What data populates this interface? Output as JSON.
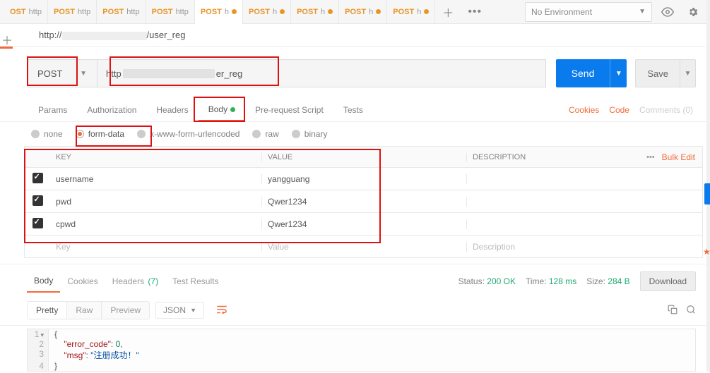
{
  "tabs": [
    {
      "method": "OST",
      "label": "http",
      "dot": false
    },
    {
      "method": "POST",
      "label": "http",
      "dot": false
    },
    {
      "method": "POST",
      "label": "http",
      "dot": false
    },
    {
      "method": "POST",
      "label": "http",
      "dot": false
    },
    {
      "method": "POST",
      "label": "h",
      "dot": true,
      "active": true
    },
    {
      "method": "POST",
      "label": "h",
      "dot": true
    },
    {
      "method": "POST",
      "label": "h",
      "dot": true
    },
    {
      "method": "POST",
      "label": "h",
      "dot": true
    },
    {
      "method": "POST",
      "label": "h",
      "dot": true
    }
  ],
  "env": {
    "label": "No Environment"
  },
  "breadcrumb": {
    "prefix": "http://",
    "suffix": "/user_reg"
  },
  "request": {
    "method": "POST",
    "url_prefix": "http",
    "url_suffix": "er_reg",
    "send": "Send",
    "save": "Save"
  },
  "req_tabs": {
    "params": "Params",
    "auth": "Authorization",
    "headers": "Headers",
    "body": "Body",
    "prereq": "Pre-request Script",
    "tests": "Tests",
    "cookies": "Cookies",
    "code": "Code",
    "comments": "Comments (0)"
  },
  "body_types": {
    "none": "none",
    "formdata": "form-data",
    "urlencoded": "x-www-form-urlencoded",
    "raw": "raw",
    "binary": "binary"
  },
  "table": {
    "key_header": "KEY",
    "value_header": "VALUE",
    "desc_header": "DESCRIPTION",
    "bulk": "Bulk Edit",
    "key_placeholder": "Key",
    "value_placeholder": "Value",
    "desc_placeholder": "Description",
    "rows": [
      {
        "key": "username",
        "value": "yangguang"
      },
      {
        "key": "pwd",
        "value": "Qwer1234"
      },
      {
        "key": "cpwd",
        "value": "Qwer1234"
      }
    ]
  },
  "response": {
    "tabs": {
      "body": "Body",
      "cookies": "Cookies",
      "headers": "Headers",
      "headers_count": "(7)",
      "tests": "Test Results"
    },
    "status_label": "Status:",
    "status": "200 OK",
    "time_label": "Time:",
    "time": "128 ms",
    "size_label": "Size:",
    "size": "284 B",
    "download": "Download",
    "view": {
      "pretty": "Pretty",
      "raw": "Raw",
      "preview": "Preview",
      "json": "JSON"
    },
    "body_lines": [
      "{",
      "    \"error_code\": 0,",
      "    \"msg\": \"注册成功！\"",
      "}"
    ]
  }
}
